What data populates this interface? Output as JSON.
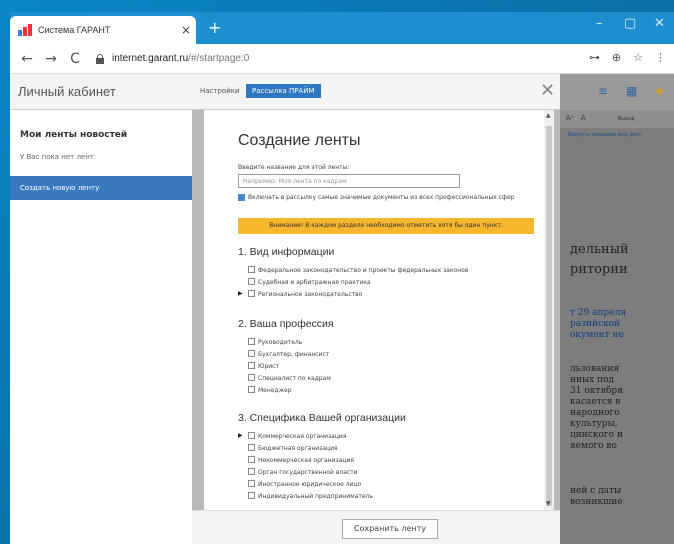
{
  "browser": {
    "tab_title": "Система ГАРАНТ",
    "tab_close": "×",
    "new_tab": "+",
    "window_controls": [
      "–",
      "▢",
      "✕"
    ],
    "url_host": "internet.garant.ru",
    "url_path": "/#/startpage:0",
    "nav": {
      "back": "←",
      "forward": "→",
      "reload": "C"
    },
    "addr_icons": [
      "⊶",
      "⊕",
      "☆",
      "⋮"
    ]
  },
  "modal": {
    "title": "Личный кабинет",
    "tabs": [
      "Настройки",
      "Рассылка ПРАЙМ"
    ],
    "close": "✕",
    "sidebar": {
      "heading": "Мои ленты новостей",
      "note": "У Вас пока нет лент",
      "create_button": "Создать новую ленту"
    },
    "form": {
      "title": "Создание ленты",
      "name_label": "Введите название для этой ленты:",
      "name_placeholder": "Например: Моя лента по кадрам",
      "include_checkbox": "Включать в рассылку самые значимые документы из всех профессиональных сфер",
      "warning": "Внимание! В каждом разделе необходимо отметить хотя бы один пункт.",
      "sections": [
        {
          "title": "1. Вид информации",
          "items": [
            "Федеральное законодательство и проекты федеральных законов",
            "Судебная и арбитражная практика",
            "Региональное законодательство"
          ]
        },
        {
          "title": "2. Ваша профессия",
          "items": [
            "Руководитель",
            "Бухгалтер, финансист",
            "Юрист",
            "Специалист по кадрам",
            "Менеджер"
          ]
        },
        {
          "title": "3. Специфика Вашей организации",
          "items": [
            "Коммерческая организация",
            "Бюджетная организация",
            "Некоммерческая организация",
            "Орган государственной власти",
            "Иностранное юридическое лицо",
            "Индивидуальный предприниматель"
          ]
        }
      ],
      "save_button": "Сохранить ленту"
    }
  },
  "background_page": {
    "toolbar": [
      "A⁺",
      "A",
      "Выход"
    ],
    "link": "Вернуть правовой вид лент",
    "lines": [
      "дельный",
      "ритории",
      "т 29 апреля",
      "разийской",
      "окумент не",
      "льзования",
      "нных под",
      "31 октября",
      "касается в",
      "народного",
      "культуры,",
      "цинского и",
      "яемого во",
      "ней с даты",
      "возникшие"
    ]
  }
}
